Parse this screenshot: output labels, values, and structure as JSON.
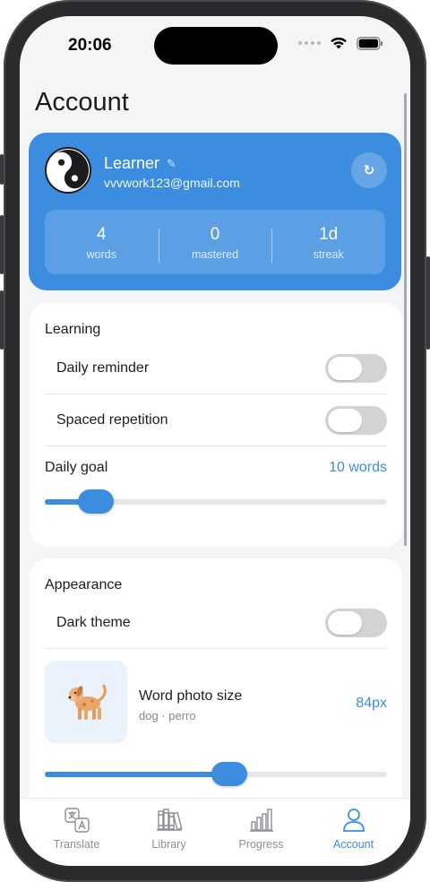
{
  "status_bar": {
    "time": "20:06"
  },
  "page": {
    "title": "Account"
  },
  "profile": {
    "name": "Learner",
    "email": "vvvwork123@gmail.com",
    "refresh_glyph": "↻",
    "edit_glyph": "✎",
    "stats": [
      {
        "value": "4",
        "label": "words"
      },
      {
        "value": "0",
        "label": "mastered"
      },
      {
        "value": "1d",
        "label": "streak"
      }
    ]
  },
  "learning": {
    "title": "Learning",
    "daily_reminder": {
      "label": "Daily reminder",
      "on": false
    },
    "spaced_repetition": {
      "label": "Spaced repetition",
      "on": false
    },
    "daily_goal": {
      "label": "Daily goal",
      "value": "10 words",
      "fraction": 0.15
    }
  },
  "appearance": {
    "title": "Appearance",
    "dark_theme": {
      "label": "Dark theme",
      "on": false
    },
    "photo_size": {
      "label": "Word photo size",
      "sub": "dog · perro",
      "value": "84px",
      "fraction": 0.54
    }
  },
  "tabs": [
    {
      "label": "Translate",
      "icon": "translate-icon",
      "active": false
    },
    {
      "label": "Library",
      "icon": "library-icon",
      "active": false
    },
    {
      "label": "Progress",
      "icon": "progress-icon",
      "active": false
    },
    {
      "label": "Account",
      "icon": "account-icon",
      "active": true
    }
  ],
  "colors": {
    "accent": "#3c8ddf",
    "background": "#f4f5f7",
    "toggle_off": "#d3d3d6"
  }
}
